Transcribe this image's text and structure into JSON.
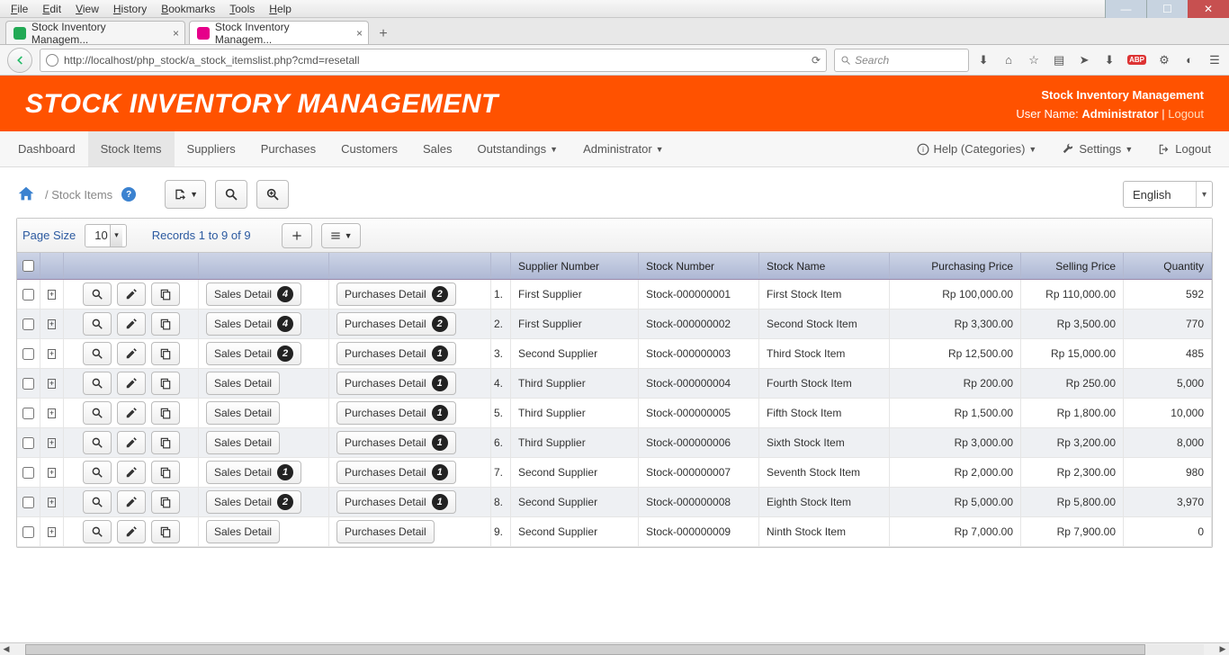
{
  "browser": {
    "menus": [
      "File",
      "Edit",
      "View",
      "History",
      "Bookmarks",
      "Tools",
      "Help"
    ],
    "tabs": [
      {
        "title": "Stock Inventory Managem...",
        "active": false,
        "favcolor": "#2a5"
      },
      {
        "title": "Stock Inventory Managem...",
        "active": true,
        "favcolor": "#e6008a"
      }
    ],
    "url": "http://localhost/php_stock/a_stock_itemslist.php?cmd=resetall",
    "search_placeholder": "Search"
  },
  "header": {
    "brand": "STOCK INVENTORY MANAGEMENT",
    "site_name": "Stock Inventory Management",
    "username_label": "User Name: ",
    "username": "Administrator",
    "logout": "Logout"
  },
  "nav": {
    "dashboard": "Dashboard",
    "stock_items": "Stock Items",
    "suppliers": "Suppliers",
    "purchases": "Purchases",
    "customers": "Customers",
    "sales": "Sales",
    "outstandings": "Outstandings",
    "administrator": "Administrator",
    "help": "Help (Categories)",
    "settings": "Settings",
    "logout": "Logout"
  },
  "breadcrumb": {
    "label": "Stock Items",
    "badge": "?"
  },
  "lang": "English",
  "grid_toolbar": {
    "page_size_label": "Page Size",
    "page_size_value": "10",
    "records_text": "Records 1 to 9 of 9"
  },
  "columns": {
    "supplier": "Supplier Number",
    "stock_number": "Stock Number",
    "stock_name": "Stock Name",
    "purchasing_price": "Purchasing Price",
    "selling_price": "Selling Price",
    "quantity": "Quantity"
  },
  "labels": {
    "sales_detail": "Sales Detail",
    "purchases_detail": "Purchases Detail"
  },
  "rows": [
    {
      "n": "1.",
      "sales_badge": "4",
      "purch_badge": "2",
      "supplier": "First Supplier",
      "stock_number": "Stock-000000001",
      "stock_name": "First Stock Item",
      "pprice": "Rp 100,000.00",
      "sprice": "Rp 110,000.00",
      "qty": "592"
    },
    {
      "n": "2.",
      "sales_badge": "4",
      "purch_badge": "2",
      "supplier": "First Supplier",
      "stock_number": "Stock-000000002",
      "stock_name": "Second Stock Item",
      "pprice": "Rp 3,300.00",
      "sprice": "Rp 3,500.00",
      "qty": "770"
    },
    {
      "n": "3.",
      "sales_badge": "2",
      "purch_badge": "1",
      "supplier": "Second Supplier",
      "stock_number": "Stock-000000003",
      "stock_name": "Third Stock Item",
      "pprice": "Rp 12,500.00",
      "sprice": "Rp 15,000.00",
      "qty": "485"
    },
    {
      "n": "4.",
      "sales_badge": "",
      "purch_badge": "1",
      "supplier": "Third Supplier",
      "stock_number": "Stock-000000004",
      "stock_name": "Fourth Stock Item",
      "pprice": "Rp 200.00",
      "sprice": "Rp 250.00",
      "qty": "5,000"
    },
    {
      "n": "5.",
      "sales_badge": "",
      "purch_badge": "1",
      "supplier": "Third Supplier",
      "stock_number": "Stock-000000005",
      "stock_name": "Fifth Stock Item",
      "pprice": "Rp 1,500.00",
      "sprice": "Rp 1,800.00",
      "qty": "10,000"
    },
    {
      "n": "6.",
      "sales_badge": "",
      "purch_badge": "1",
      "supplier": "Third Supplier",
      "stock_number": "Stock-000000006",
      "stock_name": "Sixth Stock Item",
      "pprice": "Rp 3,000.00",
      "sprice": "Rp 3,200.00",
      "qty": "8,000"
    },
    {
      "n": "7.",
      "sales_badge": "1",
      "purch_badge": "1",
      "supplier": "Second Supplier",
      "stock_number": "Stock-000000007",
      "stock_name": "Seventh Stock Item",
      "pprice": "Rp 2,000.00",
      "sprice": "Rp 2,300.00",
      "qty": "980"
    },
    {
      "n": "8.",
      "sales_badge": "2",
      "purch_badge": "1",
      "supplier": "Second Supplier",
      "stock_number": "Stock-000000008",
      "stock_name": "Eighth Stock Item",
      "pprice": "Rp 5,000.00",
      "sprice": "Rp 5,800.00",
      "qty": "3,970"
    },
    {
      "n": "9.",
      "sales_badge": "",
      "purch_badge": "",
      "supplier": "Second Supplier",
      "stock_number": "Stock-000000009",
      "stock_name": "Ninth Stock Item",
      "pprice": "Rp 7,000.00",
      "sprice": "Rp 7,900.00",
      "qty": "0"
    }
  ]
}
